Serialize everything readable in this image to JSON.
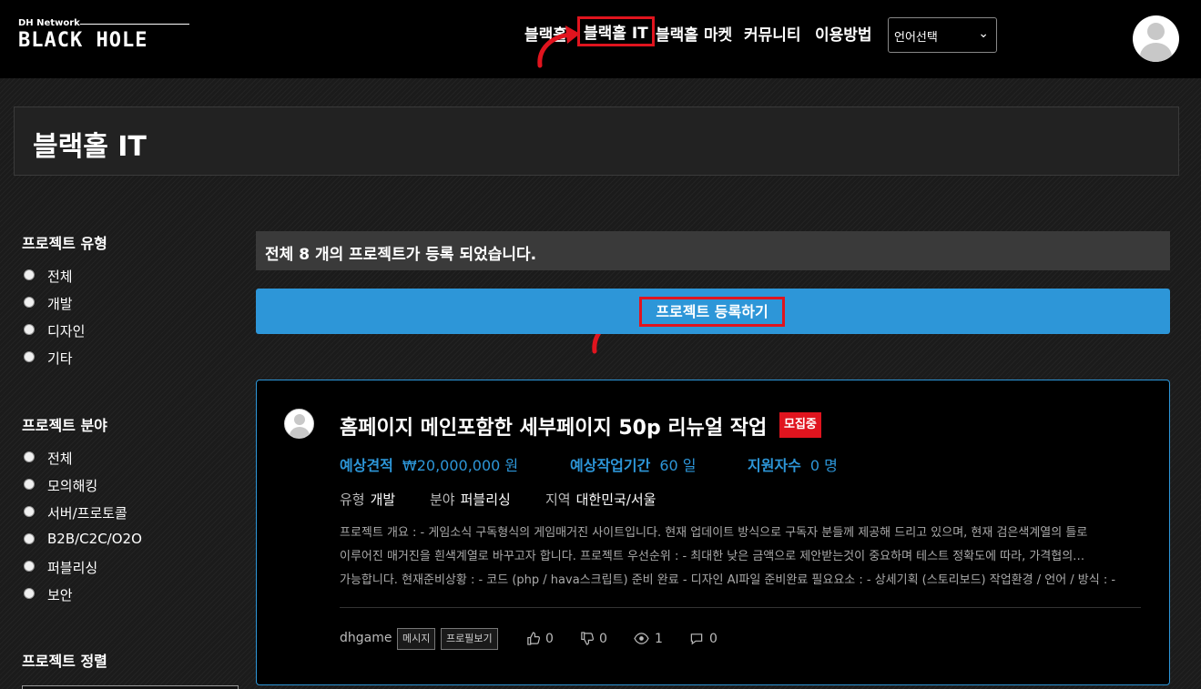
{
  "header": {
    "logo_sub": "DH Network",
    "logo_main": "BLACK HOLE",
    "nav": [
      "블랙홀",
      "블랙홀 IT",
      "블랙홀 마켓",
      "커뮤니티",
      "이용방법"
    ],
    "language_select": "언어선택"
  },
  "page": {
    "title": "블랙홀 IT"
  },
  "sidebar": {
    "type_heading": "프로젝트 유형",
    "type_options": [
      "전체",
      "개발",
      "디자인",
      "기타"
    ],
    "field_heading": "프로젝트 분야",
    "field_options": [
      "전체",
      "모의해킹",
      "서버/프로토콜",
      "B2B/C2C/O2O",
      "퍼블리싱",
      "보안"
    ],
    "sort_heading": "프로젝트 정렬"
  },
  "main": {
    "total_text": "전체 8 개의 프로젝트가 등록 되었습니다.",
    "register_label": "프로젝트 등록하기"
  },
  "project": {
    "title": "홈페이지 메인포함한 세부페이지 50p 리뉴얼 작업",
    "badge": "모집중",
    "estimate_label": "예상견적",
    "estimate_value": "₩20,000,000 원",
    "period_label": "예상작업기간",
    "period_value": "60 일",
    "applicants_label": "지원자수",
    "applicants_value": "0 명",
    "type_label": "유형",
    "type_value": "개발",
    "field_label": "분야",
    "field_value": "퍼블리싱",
    "region_label": "지역",
    "region_value": "대한민국/서울",
    "desc_line1": "프로젝트 개요 : - 게임소식 구독형식의 게임매거진 사이트입니다. 현재 업데이트 방식으로 구독자 분들께 제공해 드리고 있으며, 현재 검은색계열의 틀로",
    "desc_line2": "이루어진 매거진을 흰색계열로 바꾸고자 합니다. 프로젝트 우선순위 : - 최대한 낮은 금액으로 제안받는것이 중요하며 테스트 정확도에 따라, 가격협의…",
    "desc_line3": "가능합니다. 현재준비상황 : - 코드 (php / hava스크립트) 준비 완료 - 디자인 AI파일 준비완료 필요요소 : - 상세기획 (스토리보드) 작업환경 / 언어 / 방식 : -",
    "author": "dhgame",
    "message_btn": "메시지",
    "profile_btn": "프로필보기",
    "likes": "0",
    "dislikes": "0",
    "views": "1",
    "comments": "0"
  },
  "colors": {
    "accent": "#2d96d8",
    "highlight": "#e0141e",
    "badge": "#e0141e"
  }
}
